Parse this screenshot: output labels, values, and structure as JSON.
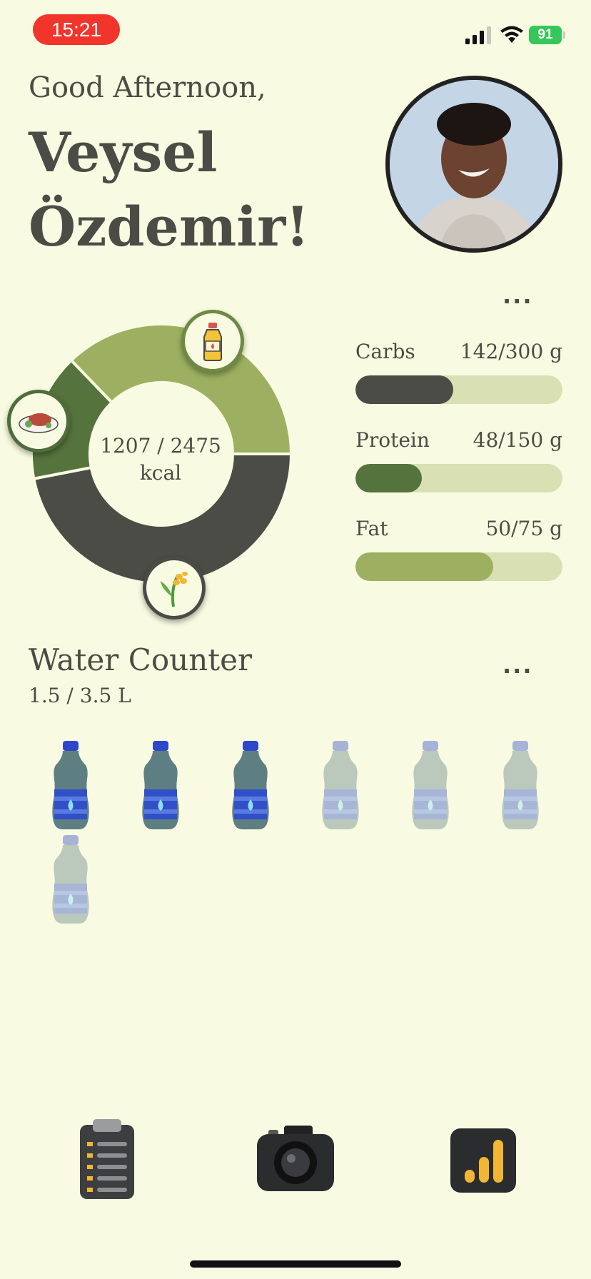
{
  "status_bar": {
    "time": "15:21",
    "battery": "91"
  },
  "greeting": "Good Afternoon,",
  "user_name": "Veysel Özdemir!",
  "calories": {
    "text_line1": "1207 / 2475",
    "text_line2": "kcal"
  },
  "macros": [
    {
      "name": "Carbs",
      "value": "142/300 g",
      "current": 142,
      "goal": 300,
      "color": "#4b4c45"
    },
    {
      "name": "Protein",
      "value": "48/150 g",
      "current": 48,
      "goal": 150,
      "color": "#55733c"
    },
    {
      "name": "Fat",
      "value": "50/75 g",
      "current": 50,
      "goal": 75,
      "color": "#9db061"
    }
  ],
  "more_label": "...",
  "water": {
    "title": "Water Counter",
    "amount": "1.5 / 3.5 L",
    "bottles_total": 7,
    "bottles_filled": 3
  },
  "colors": {
    "background": "#f8fbe2",
    "text": "#4b4c45",
    "carbs": "#4b4c45",
    "protein": "#55733c",
    "fat": "#9db061",
    "track": "#d8e0b4"
  },
  "nav": [
    {
      "name": "log",
      "icon": "clipboard-icon"
    },
    {
      "name": "camera",
      "icon": "camera-icon"
    },
    {
      "name": "stats",
      "icon": "bar-chart-icon"
    }
  ]
}
